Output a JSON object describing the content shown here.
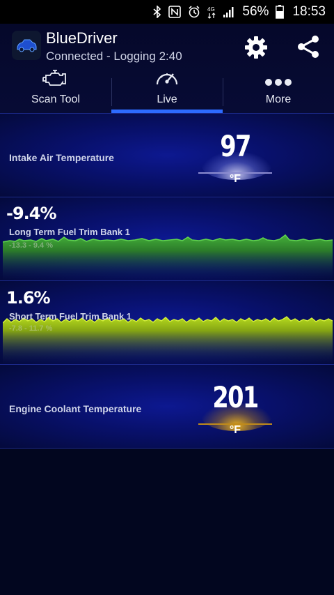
{
  "status": {
    "battery": "56%",
    "time": "18:53"
  },
  "app": {
    "title": "BlueDriver",
    "subtitle": "Connected - Logging 2:40"
  },
  "tabs": [
    {
      "label": "Scan Tool",
      "icon": "engine-icon"
    },
    {
      "label": "Live",
      "icon": "speedometer-icon",
      "active": true
    },
    {
      "label": "More",
      "icon": "more-dots-icon"
    }
  ],
  "gauges": {
    "intake": {
      "label": "Intake Air Temperature",
      "value": "97",
      "unit": "°F",
      "glow_color": "#dcdcff"
    },
    "ltft": {
      "label": "Long Term Fuel Trim Bank 1",
      "value": "-9.4%",
      "range": "-13.3 - 9.4 %",
      "color": "#3fa635"
    },
    "stft": {
      "label": "Short Term Fuel Trim Bank 1",
      "value": "1.6%",
      "range": "-7.8 - 11.7 %",
      "color": "#a9d21a"
    },
    "coolant": {
      "label": "Engine Coolant Temperature",
      "value": "201",
      "unit": "°F",
      "glow_color": "#f0b418"
    }
  }
}
